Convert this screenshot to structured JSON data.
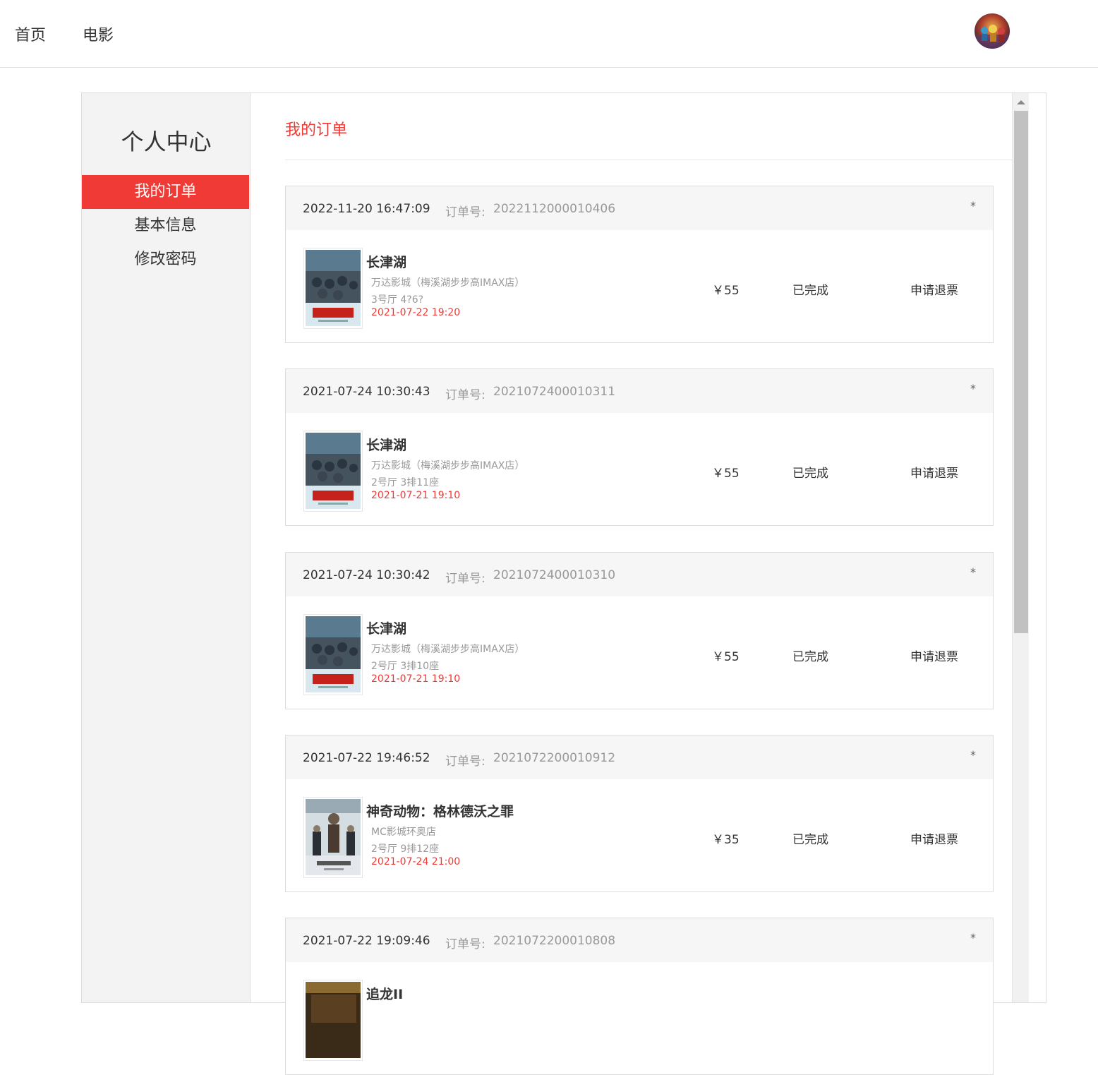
{
  "nav": {
    "home": "首页",
    "movie": "电影"
  },
  "sidebar": {
    "title": "个人中心",
    "items": [
      {
        "label": "我的订单",
        "active": true
      },
      {
        "label": "基本信息",
        "active": false
      },
      {
        "label": "修改密码",
        "active": false
      }
    ]
  },
  "content": {
    "title": "我的订单"
  },
  "colors": {
    "accent": "#ef3a35"
  },
  "orders": [
    {
      "time": "2022-11-20 16:47:09",
      "no_label": "订单号:",
      "no": "2022112000010406",
      "delete": "*",
      "movie": "长津湖",
      "cinema": "万达影城（梅溪湖步步高IMAX店）",
      "seat": "3号厅 4?6?",
      "showtime": "2021-07-22 19:20",
      "price": "￥55",
      "status": "已完成",
      "action": "申请退票",
      "poster": "changjinhu"
    },
    {
      "time": "2021-07-24 10:30:43",
      "no_label": "订单号:",
      "no": "2021072400010311",
      "delete": "*",
      "movie": "长津湖",
      "cinema": "万达影城（梅溪湖步步高IMAX店）",
      "seat": "2号厅 3排11座",
      "showtime": "2021-07-21 19:10",
      "price": "￥55",
      "status": "已完成",
      "action": "申请退票",
      "poster": "changjinhu"
    },
    {
      "time": "2021-07-24 10:30:42",
      "no_label": "订单号:",
      "no": "2021072400010310",
      "delete": "*",
      "movie": "长津湖",
      "cinema": "万达影城（梅溪湖步步高IMAX店）",
      "seat": "2号厅 3排10座",
      "showtime": "2021-07-21 19:10",
      "price": "￥55",
      "status": "已完成",
      "action": "申请退票",
      "poster": "changjinhu"
    },
    {
      "time": "2021-07-22 19:46:52",
      "no_label": "订单号:",
      "no": "2021072200010912",
      "delete": "*",
      "movie": "神奇动物：格林德沃之罪",
      "cinema": "MC影城环奥店",
      "seat": "2号厅 9排12座",
      "showtime": "2021-07-24 21:00",
      "price": "￥35",
      "status": "已完成",
      "action": "申请退票",
      "poster": "fantastic-beasts"
    },
    {
      "time": "2021-07-22 19:09:46",
      "no_label": "订单号:",
      "no": "2021072200010808",
      "delete": "*",
      "movie": "追龙II",
      "cinema": "",
      "seat": "",
      "showtime": "",
      "price": "",
      "status": "",
      "action": "",
      "poster": "zhuilong"
    }
  ]
}
